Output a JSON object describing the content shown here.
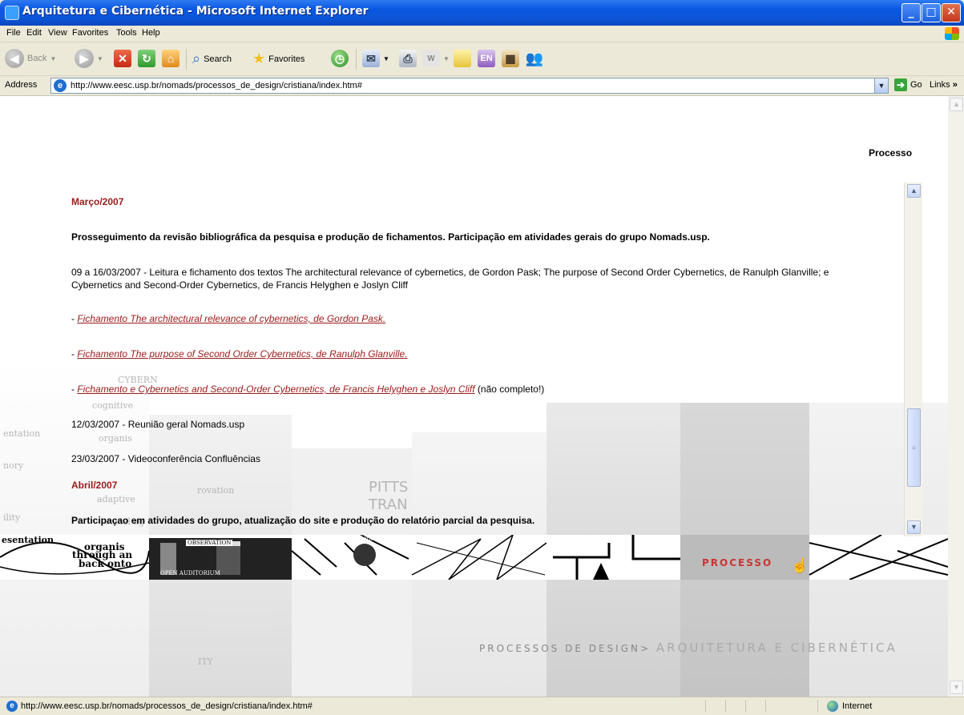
{
  "window": {
    "title": "Arquitetura e Cibernética - Microsoft Internet Explorer",
    "min_label": "_",
    "max_label": "□",
    "close_label": "✕"
  },
  "menu": [
    "File",
    "Edit",
    "View",
    "Favorites",
    "Tools",
    "Help"
  ],
  "toolbar": {
    "back_label": "Back",
    "search_label": "Search",
    "favorites_label": "Favorites"
  },
  "address": {
    "label": "Address",
    "url": "http://www.eesc.usp.br/nomads/processos_de_design/cristiana/index.htm#",
    "go_label": "Go",
    "links_label": "Links"
  },
  "page": {
    "header_label": "Processo",
    "entries": {
      "march_heading": "Março/2007",
      "march_summary": "Prosseguimento da revisão bibliográfica da pesquisa e produção de fichamentos. Participação em atividades gerais do grupo Nomads.usp.",
      "reading_line1": "09 a 16/03/2007 - Leitura e fichamento dos textos The architectural relevance of cybernetics, de Gordon Pask; The purpose of Second Order Cybernetics, de Ranulph Glanville; e",
      "reading_line2": "Cybernetics and Second-Order Cybernetics, de Francis Helyghen e Joslyn Cliff",
      "dash": "- ",
      "link1": "Fichamento The architectural relevance of cybernetics, de Gordon Pask.",
      "link2": "Fichamento The purpose of Second Order Cybernetics, de Ranulph Glanville.",
      "link3": "Fichamento e Cybernetics and Second-Order Cybernetics, de Francis Helyghen e Joslyn Cliff",
      "link3_note": " (não completo!)",
      "event1": "12/03/2007 - Reunião geral Nomads.usp",
      "event2": "23/03/2007 - Videoconferência Confluências",
      "april_heading": "Abril/2007",
      "april_summary": "Participaçao em atividades do grupo, atualização do site e produção do relatório parcial da pesquisa."
    },
    "nav_processo": "PROCESSO",
    "footer_small": "PROCESSOS DE DESIGN>",
    "footer_big": "ARQUITETURA E CIBERNÉTICA",
    "bg_words": [
      "entation",
      "nory",
      "ility",
      "esentation",
      "organis",
      "through an",
      "back onto",
      "CYBERN",
      "cognitive",
      "organis",
      "adaptive",
      "social ag",
      "rovation",
      "PITTS",
      "TRAN",
      "OBSERVATION",
      "OPEN AUDITORIUM",
      "Guralem",
      "ITY"
    ]
  },
  "status": {
    "text": "http://www.eesc.usp.br/nomads/processos_de_design/cristiana/index.htm#",
    "zone": "Internet"
  }
}
